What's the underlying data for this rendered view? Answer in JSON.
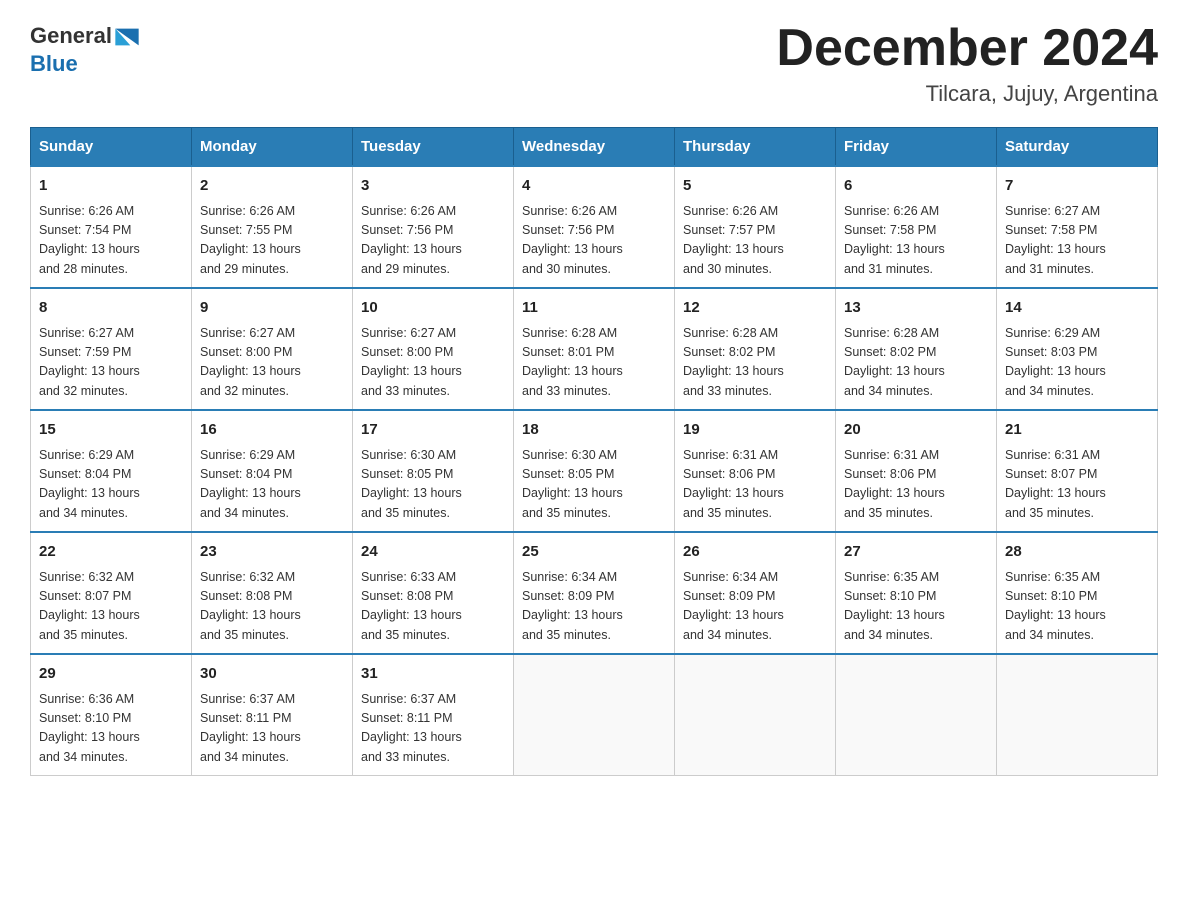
{
  "header": {
    "logo_general": "General",
    "logo_blue": "Blue",
    "month_title": "December 2024",
    "location": "Tilcara, Jujuy, Argentina"
  },
  "weekdays": [
    "Sunday",
    "Monday",
    "Tuesday",
    "Wednesday",
    "Thursday",
    "Friday",
    "Saturday"
  ],
  "weeks": [
    [
      {
        "day": "1",
        "sunrise": "6:26 AM",
        "sunset": "7:54 PM",
        "daylight": "13 hours and 28 minutes."
      },
      {
        "day": "2",
        "sunrise": "6:26 AM",
        "sunset": "7:55 PM",
        "daylight": "13 hours and 29 minutes."
      },
      {
        "day": "3",
        "sunrise": "6:26 AM",
        "sunset": "7:56 PM",
        "daylight": "13 hours and 29 minutes."
      },
      {
        "day": "4",
        "sunrise": "6:26 AM",
        "sunset": "7:56 PM",
        "daylight": "13 hours and 30 minutes."
      },
      {
        "day": "5",
        "sunrise": "6:26 AM",
        "sunset": "7:57 PM",
        "daylight": "13 hours and 30 minutes."
      },
      {
        "day": "6",
        "sunrise": "6:26 AM",
        "sunset": "7:58 PM",
        "daylight": "13 hours and 31 minutes."
      },
      {
        "day": "7",
        "sunrise": "6:27 AM",
        "sunset": "7:58 PM",
        "daylight": "13 hours and 31 minutes."
      }
    ],
    [
      {
        "day": "8",
        "sunrise": "6:27 AM",
        "sunset": "7:59 PM",
        "daylight": "13 hours and 32 minutes."
      },
      {
        "day": "9",
        "sunrise": "6:27 AM",
        "sunset": "8:00 PM",
        "daylight": "13 hours and 32 minutes."
      },
      {
        "day": "10",
        "sunrise": "6:27 AM",
        "sunset": "8:00 PM",
        "daylight": "13 hours and 33 minutes."
      },
      {
        "day": "11",
        "sunrise": "6:28 AM",
        "sunset": "8:01 PM",
        "daylight": "13 hours and 33 minutes."
      },
      {
        "day": "12",
        "sunrise": "6:28 AM",
        "sunset": "8:02 PM",
        "daylight": "13 hours and 33 minutes."
      },
      {
        "day": "13",
        "sunrise": "6:28 AM",
        "sunset": "8:02 PM",
        "daylight": "13 hours and 34 minutes."
      },
      {
        "day": "14",
        "sunrise": "6:29 AM",
        "sunset": "8:03 PM",
        "daylight": "13 hours and 34 minutes."
      }
    ],
    [
      {
        "day": "15",
        "sunrise": "6:29 AM",
        "sunset": "8:04 PM",
        "daylight": "13 hours and 34 minutes."
      },
      {
        "day": "16",
        "sunrise": "6:29 AM",
        "sunset": "8:04 PM",
        "daylight": "13 hours and 34 minutes."
      },
      {
        "day": "17",
        "sunrise": "6:30 AM",
        "sunset": "8:05 PM",
        "daylight": "13 hours and 35 minutes."
      },
      {
        "day": "18",
        "sunrise": "6:30 AM",
        "sunset": "8:05 PM",
        "daylight": "13 hours and 35 minutes."
      },
      {
        "day": "19",
        "sunrise": "6:31 AM",
        "sunset": "8:06 PM",
        "daylight": "13 hours and 35 minutes."
      },
      {
        "day": "20",
        "sunrise": "6:31 AM",
        "sunset": "8:06 PM",
        "daylight": "13 hours and 35 minutes."
      },
      {
        "day": "21",
        "sunrise": "6:31 AM",
        "sunset": "8:07 PM",
        "daylight": "13 hours and 35 minutes."
      }
    ],
    [
      {
        "day": "22",
        "sunrise": "6:32 AM",
        "sunset": "8:07 PM",
        "daylight": "13 hours and 35 minutes."
      },
      {
        "day": "23",
        "sunrise": "6:32 AM",
        "sunset": "8:08 PM",
        "daylight": "13 hours and 35 minutes."
      },
      {
        "day": "24",
        "sunrise": "6:33 AM",
        "sunset": "8:08 PM",
        "daylight": "13 hours and 35 minutes."
      },
      {
        "day": "25",
        "sunrise": "6:34 AM",
        "sunset": "8:09 PM",
        "daylight": "13 hours and 35 minutes."
      },
      {
        "day": "26",
        "sunrise": "6:34 AM",
        "sunset": "8:09 PM",
        "daylight": "13 hours and 34 minutes."
      },
      {
        "day": "27",
        "sunrise": "6:35 AM",
        "sunset": "8:10 PM",
        "daylight": "13 hours and 34 minutes."
      },
      {
        "day": "28",
        "sunrise": "6:35 AM",
        "sunset": "8:10 PM",
        "daylight": "13 hours and 34 minutes."
      }
    ],
    [
      {
        "day": "29",
        "sunrise": "6:36 AM",
        "sunset": "8:10 PM",
        "daylight": "13 hours and 34 minutes."
      },
      {
        "day": "30",
        "sunrise": "6:37 AM",
        "sunset": "8:11 PM",
        "daylight": "13 hours and 34 minutes."
      },
      {
        "day": "31",
        "sunrise": "6:37 AM",
        "sunset": "8:11 PM",
        "daylight": "13 hours and 33 minutes."
      },
      null,
      null,
      null,
      null
    ]
  ],
  "labels": {
    "sunrise": "Sunrise:",
    "sunset": "Sunset:",
    "daylight": "Daylight:"
  }
}
